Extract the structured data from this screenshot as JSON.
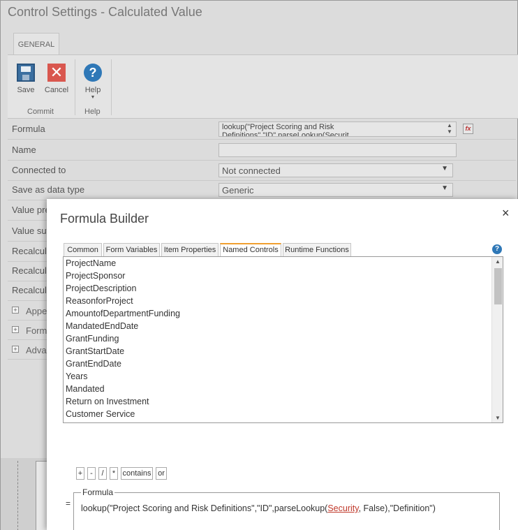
{
  "window": {
    "title": "Control Settings - Calculated Value"
  },
  "ribbon": {
    "tab_general": "GENERAL",
    "save_label": "Save",
    "cancel_label": "Cancel",
    "help_label": "Help",
    "group_commit": "Commit",
    "group_help": "Help"
  },
  "properties": {
    "formula_label": "Formula",
    "formula_value_line1": "lookup(\"Project Scoring and Risk",
    "formula_value_line2": "Definitions\",\"ID\",parseLookup(Securit",
    "name_label": "Name",
    "name_value": "",
    "connected_label": "Connected to",
    "connected_value": "Not connected",
    "datatype_label": "Save as data type",
    "datatype_value": "Generic",
    "value_prefix_label": "Value pre",
    "value_suffix_label": "Value suf",
    "recalc1_label": "Recalcula",
    "recalc2_label": "Recalcula",
    "recalc3_label": "Recalcula",
    "section_appearance": "Appe",
    "section_formatting": "Form",
    "section_advanced": "Adva"
  },
  "dialog": {
    "title": "Formula Builder",
    "close_glyph": "×",
    "help_glyph": "?",
    "tabs": [
      {
        "label": "Common",
        "active": false
      },
      {
        "label": "Form Variables",
        "active": false
      },
      {
        "label": "Item Properties",
        "active": false
      },
      {
        "label": "Named Controls",
        "active": true
      },
      {
        "label": "Runtime Functions",
        "active": false
      }
    ],
    "named_controls": [
      "ProjectName",
      "ProjectSponsor",
      "ProjectDescription",
      "ReasonforProject",
      "AmountofDepartmentFunding",
      "MandatedEndDate",
      "GrantFunding",
      "GrantStartDate",
      "GrantEndDate",
      "Years",
      "Mandated",
      "Return on Investment",
      "Customer Service"
    ],
    "operators": [
      "+",
      "-",
      "/",
      "*",
      "contains",
      "or"
    ],
    "equals": "=",
    "formula_legend": "Formula",
    "formula_before": "lookup(\"Project Scoring and Risk Definitions\",\"ID\",parseLookup(",
    "formula_ref": "Security",
    "formula_after": ", False),\"Definition\")"
  },
  "colors": {
    "accent_tab": "#f0a030",
    "help_blue": "#2f78b7",
    "reference_red": "#c0392b"
  }
}
